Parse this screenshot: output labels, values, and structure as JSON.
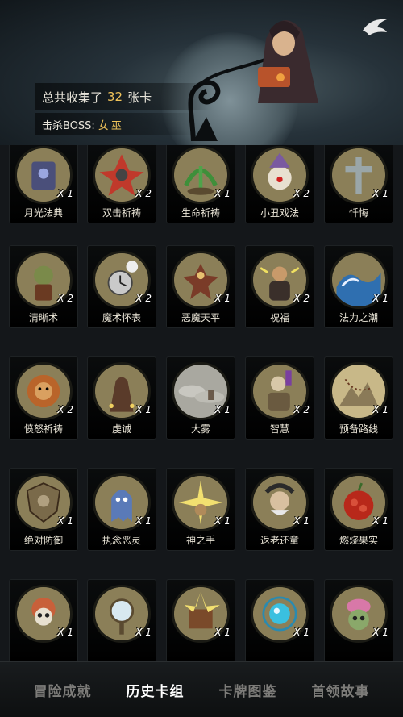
{
  "header": {
    "collect_prefix": "总共收集了",
    "collect_count": "32",
    "collect_suffix": "张卡",
    "boss_label": "击杀BOSS:",
    "boss_name": "女巫"
  },
  "cards": [
    {
      "name": "月光法典",
      "count": "X 1",
      "theme": "tome"
    },
    {
      "name": "双击祈祷",
      "count": "X 2",
      "theme": "blast"
    },
    {
      "name": "生命祈祷",
      "count": "X 1",
      "theme": "plant"
    },
    {
      "name": "小丑戏法",
      "count": "X 2",
      "theme": "clown"
    },
    {
      "name": "忏悔",
      "count": "X 1",
      "theme": "cross"
    },
    {
      "name": "清晰术",
      "count": "X 2",
      "theme": "goblin"
    },
    {
      "name": "魔术怀表",
      "count": "X 2",
      "theme": "watch"
    },
    {
      "name": "恶魔天平",
      "count": "X 1",
      "theme": "demon"
    },
    {
      "name": "祝福",
      "count": "X 2",
      "theme": "monk"
    },
    {
      "name": "法力之潮",
      "count": "X 1",
      "theme": "wave"
    },
    {
      "name": "愤怒祈祷",
      "count": "X 2",
      "theme": "lion"
    },
    {
      "name": "虔诚",
      "count": "X 1",
      "theme": "priest"
    },
    {
      "name": "大雾",
      "count": "X 1",
      "theme": "fog"
    },
    {
      "name": "智慧",
      "count": "X 2",
      "theme": "sage"
    },
    {
      "name": "预备路线",
      "count": "X 1",
      "theme": "map"
    },
    {
      "name": "绝对防御",
      "count": "X 1",
      "theme": "shield"
    },
    {
      "name": "执念恶灵",
      "count": "X 1",
      "theme": "ghost"
    },
    {
      "name": "神之手",
      "count": "X 1",
      "theme": "hand"
    },
    {
      "name": "返老还童",
      "count": "X 1",
      "theme": "oldman"
    },
    {
      "name": "燃烧果实",
      "count": "X 1",
      "theme": "fruit"
    },
    {
      "name": "",
      "count": "X 1",
      "theme": "skull"
    },
    {
      "name": "",
      "count": "X 1",
      "theme": "mirror"
    },
    {
      "name": "",
      "count": "X 1",
      "theme": "book"
    },
    {
      "name": "",
      "count": "X 1",
      "theme": "orb"
    },
    {
      "name": "",
      "count": "X 1",
      "theme": "brain"
    }
  ],
  "nav": {
    "tabs": [
      "冒险成就",
      "历史卡组",
      "卡牌图鉴",
      "首领故事"
    ],
    "active_index": 1
  },
  "colors": {
    "accent_gold": "#f0c35a",
    "art_bg": "#8a7d55",
    "tab_inactive": "#7d7c79",
    "tab_active": "#ffffff"
  }
}
